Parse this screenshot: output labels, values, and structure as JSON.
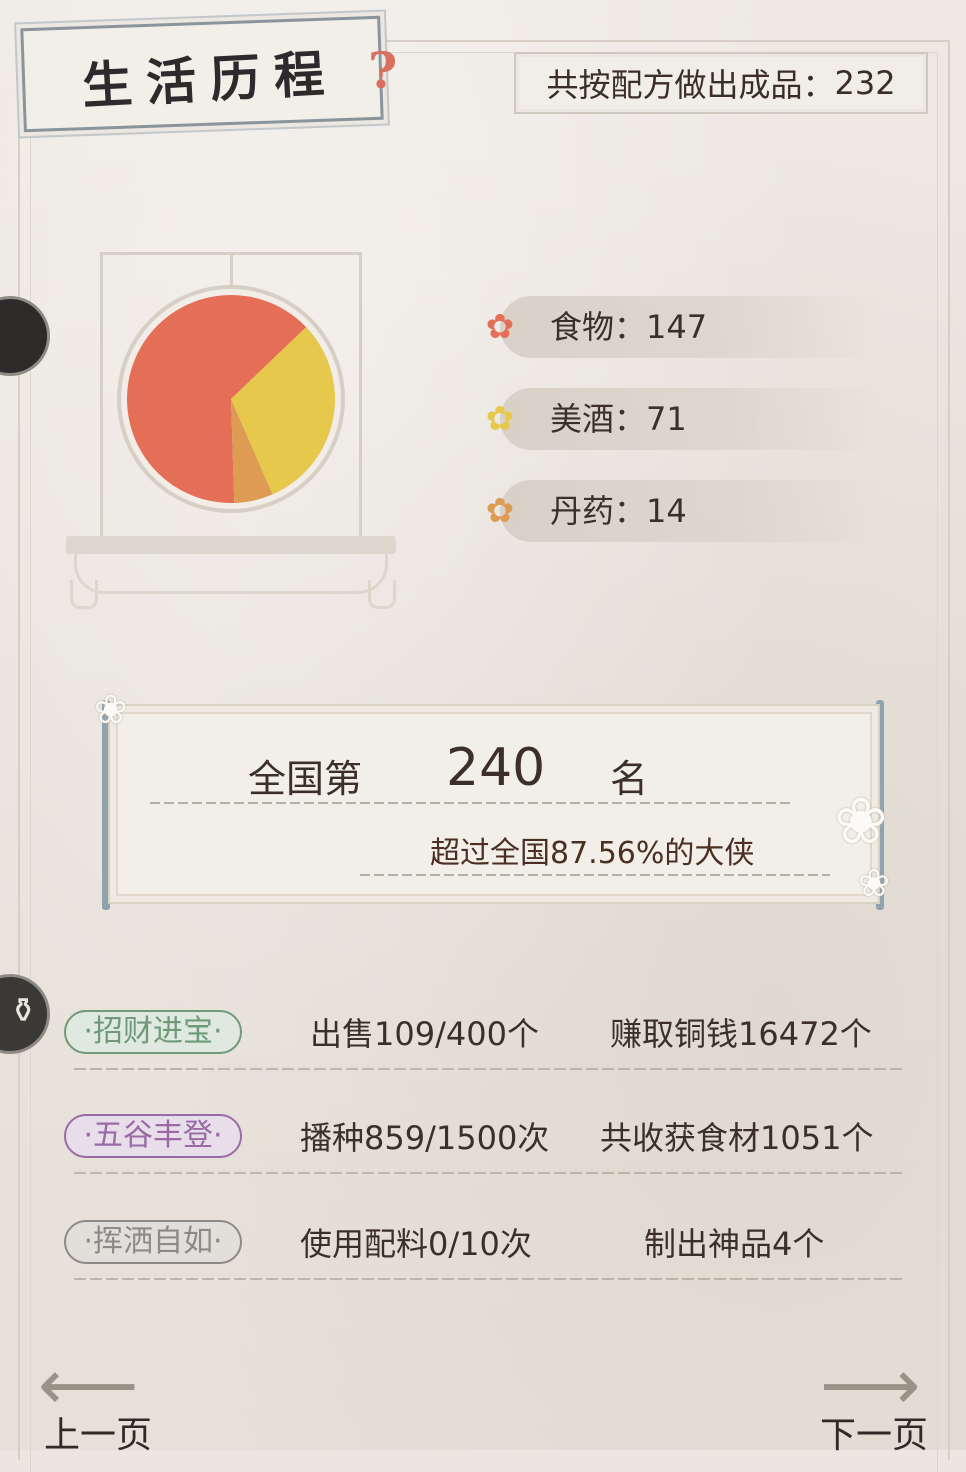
{
  "header": {
    "title": "生活历程",
    "total_label": "共按配方做出成品：",
    "total_value": "232"
  },
  "chart_data": {
    "type": "pie",
    "categories": [
      "食物",
      "美酒",
      "丹药"
    ],
    "values": [
      147,
      71,
      14
    ],
    "colors": [
      "#e46f56",
      "#e6c84c",
      "#dd9b53"
    ]
  },
  "legend": [
    {
      "label": "食物：",
      "value": "147",
      "color": "#e46f56"
    },
    {
      "label": "美酒：",
      "value": "71",
      "color": "#e6c84c"
    },
    {
      "label": "丹药：",
      "value": "14",
      "color": "#dd9b53"
    }
  ],
  "rank": {
    "prefix": "全国第",
    "number": "240",
    "suffix": "名",
    "subtitle": "超过全国87.56%的大侠"
  },
  "stats": [
    {
      "badge": "·招财进宝·",
      "a": "出售109/400个",
      "b": "赚取铜钱16472个",
      "color": "#6f9a79",
      "bg": "#dfe9df"
    },
    {
      "badge": "·五谷丰登·",
      "a": "播种859/1500次",
      "b": "共收获食材1051个",
      "color": "#9a6aa6",
      "bg": "#e7deea"
    },
    {
      "badge": "·挥洒自如·",
      "a": "使用配料0/10次",
      "b": "制出神品4个",
      "color": "#8c8a88",
      "bg": "#e2dfdb"
    }
  ],
  "nav": {
    "prev": "上一页",
    "next": "下一页"
  }
}
